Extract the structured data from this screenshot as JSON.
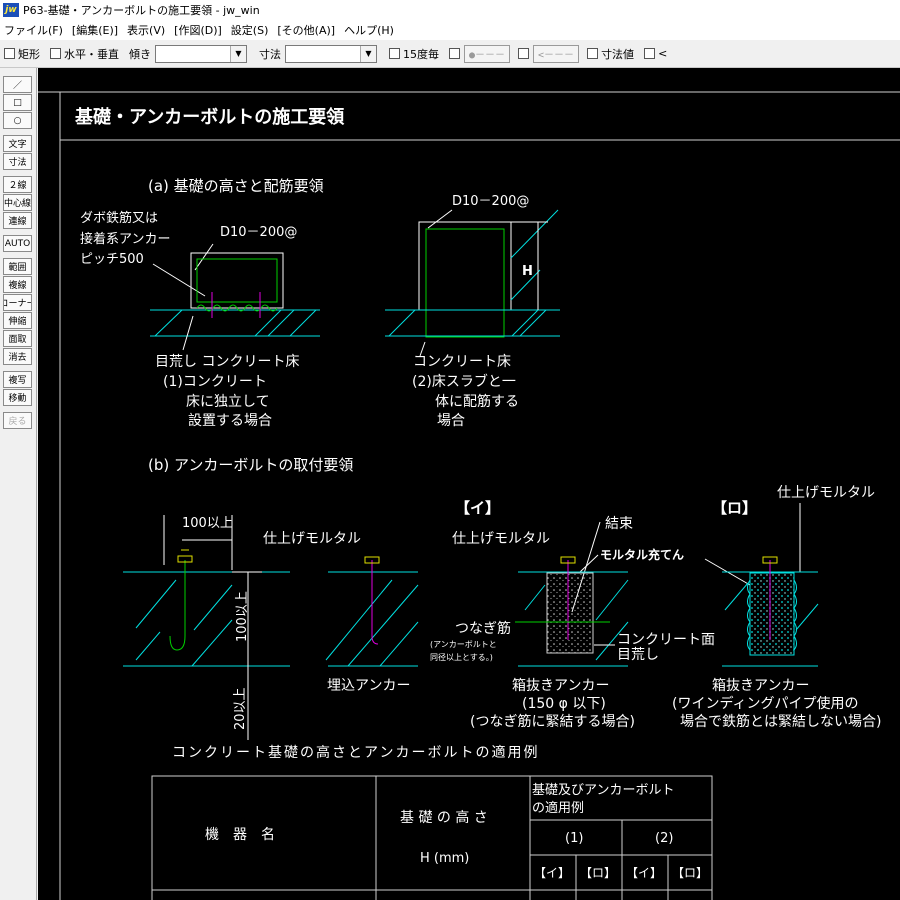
{
  "window": {
    "icon_text": "jw",
    "title": "P63-基礎・アンカーボルトの施工要領 - jw_win"
  },
  "menu": [
    "ファイル(F)",
    "[編集(E)]",
    "表示(V)",
    "[作図(D)]",
    "設定(S)",
    "[その他(A)]",
    "ヘルプ(H)"
  ],
  "toolbar": {
    "rect_label": "矩形",
    "hv_label": "水平・垂直",
    "tilt_label": "傾き",
    "dim_label": "寸法",
    "deg15_label": "15度毎",
    "point_btn": "●－－－",
    "arrow_btn": "<－－－",
    "dimval_label": "寸法値",
    "lt_label": "<"
  },
  "sidebar": [
    "／",
    "□",
    "○",
    "文字",
    "寸法",
    "２線",
    "中心線",
    "連線",
    "AUTO",
    "範囲",
    "複線",
    "コーナー",
    "伸縮",
    "面取",
    "消去",
    "複写",
    "移動",
    "戻る"
  ],
  "drawing": {
    "title": "基礎・アンカーボルトの施工要領",
    "sec_a": "(a) 基礎の高さと配筋要領",
    "a1_note1": "ダボ鉄筋又は",
    "a1_note2": "接着系アンカー",
    "a1_note3": "ピッチ500",
    "a1_bar": "D10－200@",
    "a1_cap1": "目荒し コンクリート床",
    "a1_cap2": "(1)コンクリート",
    "a1_cap3": "床に独立して",
    "a1_cap4": "設置する場合",
    "a2_bar": "D10－200@",
    "a2_h": "H",
    "a2_cap1": "コンクリート床",
    "a2_cap2": "(2)床スラブと一",
    "a2_cap3": "体に配筋する",
    "a2_cap4": "場合",
    "sec_b": "(b) アンカーボルトの取付要領",
    "b_100": "100以上",
    "b_100v": "100以上",
    "b_20v": "20以上",
    "b_mortar1": "仕上げモルタル",
    "b_embed": "埋込アンカー",
    "b_i_tag": "【イ】",
    "b_ro_tag": "【ロ】",
    "b_binding": "結束",
    "b_mortar2": "仕上げモルタル",
    "b_fill": "モルタル充てん",
    "b_mortar3": "仕上げモルタル",
    "b_tie": "つなぎ筋",
    "b_tie_note1": "(アンカーボルトと",
    "b_tie_note2": "同径以上とする。)",
    "b_surface": "コンクリート面",
    "b_rough": "目荒し",
    "b_box1": "箱抜きアンカー",
    "b_box1_sub1": "(150 φ 以下)",
    "b_box1_sub2": "(つなぎ筋に緊結する場合)",
    "b_box2": "箱抜きアンカー",
    "b_box2_sub1": "(ワインディングパイプ使用の",
    "b_box2_sub2": "場合で鉄筋とは緊結しない場合)",
    "table_caption": "コンクリート基礎の高さとアンカーボルトの適用例",
    "table": {
      "h_equipment": "機　器　名",
      "h_height1": "基 礎 の 高 さ",
      "h_height2": "H  (mm)",
      "h_apply1": "基礎及びアンカーボルト",
      "h_apply2": "の適用例",
      "h_c1": "(1)",
      "h_c2": "(2)",
      "h_i1": "【イ】",
      "h_ro1": "【ロ】",
      "h_i2": "【イ】",
      "h_ro2": "【ロ】"
    }
  },
  "colors": {
    "canvas_bg": "#000000",
    "line_white": "#ffffff",
    "line_green": "#00d000",
    "line_cyan": "#00e0e0",
    "line_magenta": "#e000e0",
    "line_yellow": "#e0e000",
    "line_gray": "#a0a0a0"
  }
}
